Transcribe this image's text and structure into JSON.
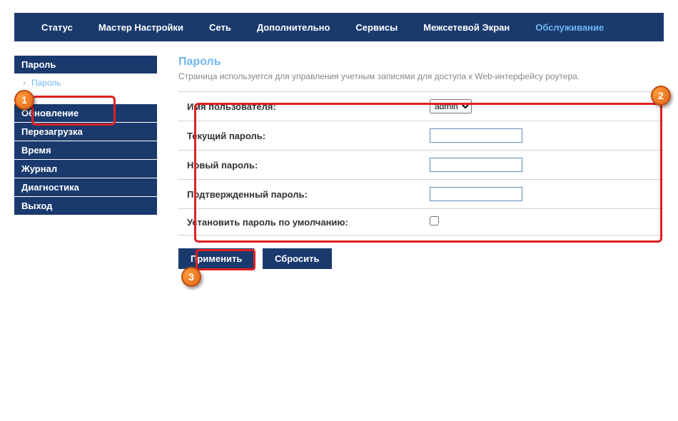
{
  "topnav": {
    "items": [
      {
        "label": "Статус"
      },
      {
        "label": "Мастер Настройки"
      },
      {
        "label": "Сеть"
      },
      {
        "label": "Дополнительно"
      },
      {
        "label": "Сервисы"
      },
      {
        "label": "Межсетевой Экран"
      },
      {
        "label": "Обслуживание",
        "active": true
      }
    ]
  },
  "sidebar": {
    "section1_header": "Пароль",
    "section1_sub": "Пароль",
    "items": [
      "Обновление",
      "Перезагрузка",
      "Время",
      "Журнал",
      "Диагностика",
      "Выход"
    ]
  },
  "page": {
    "title": "Пароль",
    "description": "Страница используется для управления учетным записями для доступа к Web-интерфейсу роутера."
  },
  "form": {
    "username_label": "Имя пользователя:",
    "username_value": "admin",
    "current_password_label": "Текущий пароль:",
    "new_password_label": "Новый пароль:",
    "confirm_password_label": "Подтвержденный пароль:",
    "default_password_label": "Установить пароль по умолчанию:"
  },
  "buttons": {
    "apply": "Применить",
    "reset": "Сбросить"
  },
  "annotations": {
    "c1": "1",
    "c2": "2",
    "c3": "3"
  }
}
